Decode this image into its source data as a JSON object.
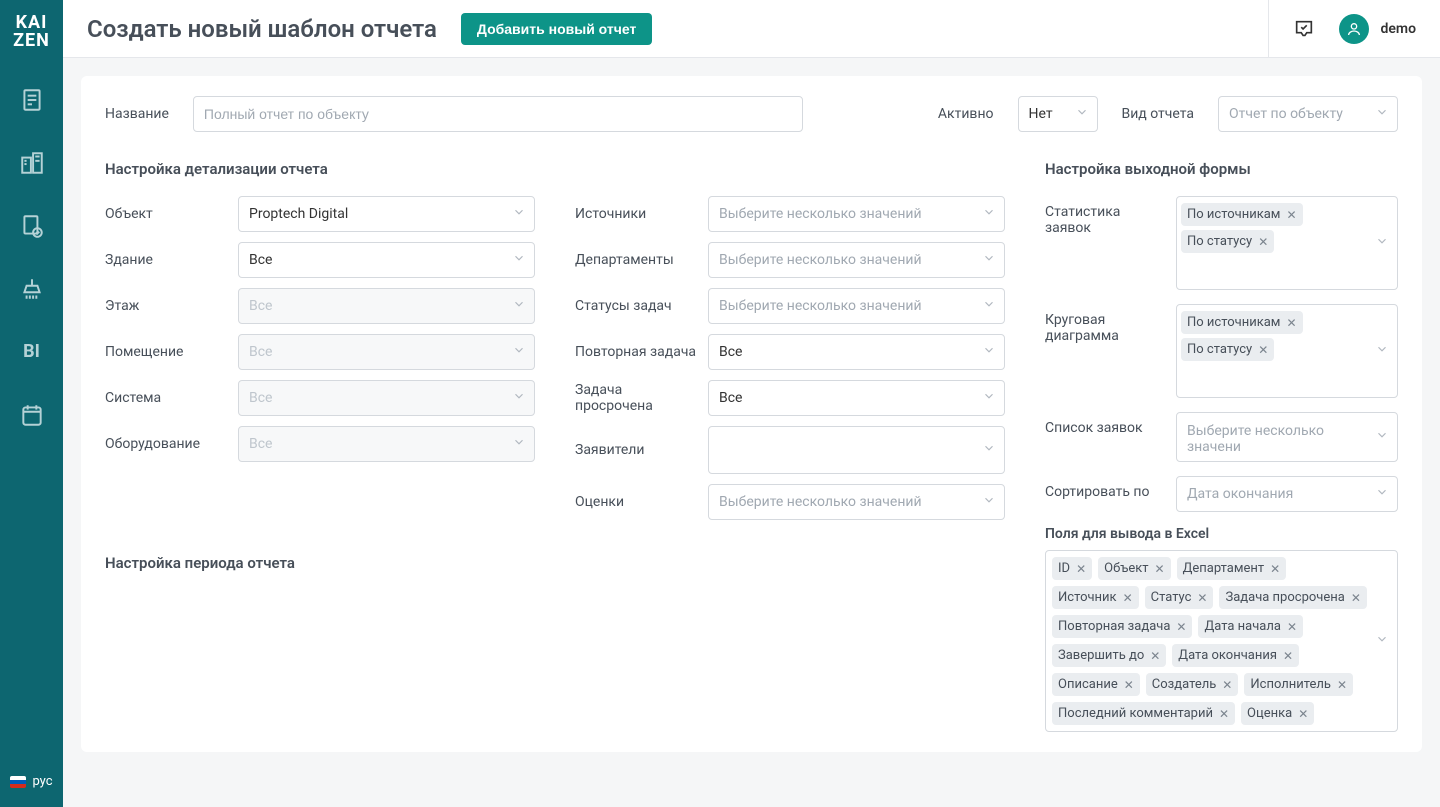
{
  "brand": {
    "line1": "KAI",
    "line2": "ZEN"
  },
  "sidebar": {
    "items": [
      {
        "name": "nav-reports"
      },
      {
        "name": "nav-buildings"
      },
      {
        "name": "nav-templates"
      },
      {
        "name": "nav-cleaning"
      },
      {
        "name": "nav-bi",
        "label": "BI"
      },
      {
        "name": "nav-calendar"
      }
    ],
    "lang": "рус"
  },
  "header": {
    "title": "Создать новый шаблон отчета",
    "add_button": "Добавить новый отчет",
    "user": "demo"
  },
  "top": {
    "name_label": "Название",
    "name_placeholder": "Полный отчет по объекту",
    "active_label": "Активно",
    "active_value": "Нет",
    "type_label": "Вид отчета",
    "type_value": "Отчет по объекту"
  },
  "detail": {
    "title": "Настройка детализации отчета",
    "left": [
      {
        "label": "Объект",
        "value": "Proptech Digital",
        "disabled": false
      },
      {
        "label": "Здание",
        "value": "Все",
        "disabled": false
      },
      {
        "label": "Этаж",
        "value": "Все",
        "disabled": true
      },
      {
        "label": "Помещение",
        "value": "Все",
        "disabled": true
      },
      {
        "label": "Система",
        "value": "Все",
        "disabled": true
      },
      {
        "label": "Оборудование",
        "value": "Все",
        "disabled": true
      }
    ],
    "right": [
      {
        "label": "Источники",
        "kind": "multi",
        "placeholder": "Выберите несколько значений"
      },
      {
        "label": "Департаменты",
        "kind": "multi",
        "placeholder": "Выберите несколько значений"
      },
      {
        "label": "Статусы задач",
        "kind": "multi",
        "placeholder": "Выберите несколько значений"
      },
      {
        "label": "Повторная задача",
        "kind": "select",
        "value": "Все"
      },
      {
        "label": "Задача просрочена",
        "kind": "select",
        "value": "Все"
      },
      {
        "label": "Заявители",
        "kind": "multi-tall",
        "placeholder": ""
      },
      {
        "label": "Оценки",
        "kind": "multi",
        "placeholder": "Выберите несколько значений"
      }
    ]
  },
  "period": {
    "title": "Настройка периода отчета"
  },
  "output": {
    "title": "Настройка выходной формы",
    "stats": {
      "label": "Статистика заявок",
      "tags": [
        "По источникам",
        "По статусу"
      ]
    },
    "pie": {
      "label": "Круговая диаграмма",
      "tags": [
        "По источникам",
        "По статусу"
      ]
    },
    "list": {
      "label": "Список заявок",
      "placeholder": "Выберите несколько значени"
    },
    "sort": {
      "label": "Сортировать по",
      "value": "Дата окончания"
    },
    "excel_title": "Поля для вывода в Excel",
    "excel_tags": [
      "ID",
      "Объект",
      "Департамент",
      "Источник",
      "Статус",
      "Задача просрочена",
      "Повторная задача",
      "Дата начала",
      "Завершить до",
      "Дата окончания",
      "Описание",
      "Создатель",
      "Исполнитель",
      "Последний комментарий",
      "Оценка"
    ]
  }
}
